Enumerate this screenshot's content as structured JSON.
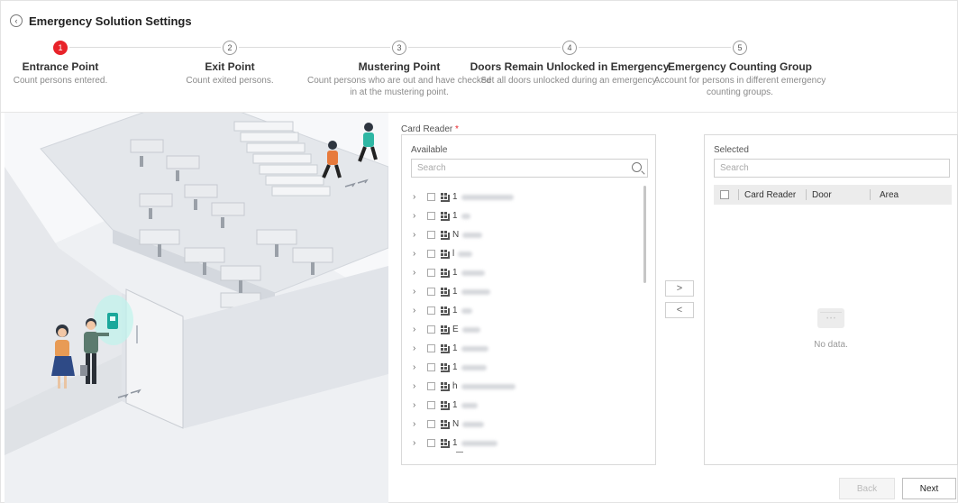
{
  "header": {
    "title": "Emergency Solution Settings",
    "back_icon": "back-circle-icon"
  },
  "stepper": {
    "active_step": 1,
    "accent_color": "#e8232a",
    "steps": [
      {
        "number": "1",
        "label": "Entrance Point",
        "desc": [
          "Count persons entered."
        ]
      },
      {
        "number": "2",
        "label": "Exit Point",
        "desc": [
          "Count exited persons."
        ]
      },
      {
        "number": "3",
        "label": "Mustering Point",
        "desc": [
          "Count persons who are out and have checked",
          "in at the mustering point."
        ]
      },
      {
        "number": "4",
        "label": "Doors Remain Unlocked in Emergency",
        "desc": [
          "Set all doors unlocked during an emergency."
        ]
      },
      {
        "number": "5",
        "label": "Emergency Counting Group",
        "desc": [
          "Account for persons in different emergency",
          "counting groups."
        ]
      }
    ]
  },
  "card_reader": {
    "label": "Card Reader",
    "required_mark": "*",
    "available": {
      "title": "Available",
      "search_placeholder": "Search",
      "items": [
        {
          "prefix": "1",
          "blur": 58
        },
        {
          "prefix": "1",
          "blur": 10
        },
        {
          "prefix": "N",
          "blur": 22
        },
        {
          "prefix": "l",
          "blur": 16
        },
        {
          "prefix": "1",
          "blur": 26
        },
        {
          "prefix": "1",
          "blur": 32
        },
        {
          "prefix": "1",
          "blur": 12
        },
        {
          "prefix": "E",
          "blur": 20
        },
        {
          "prefix": "1",
          "blur": 30
        },
        {
          "prefix": "1",
          "blur": 28
        },
        {
          "prefix": "h",
          "blur": 60
        },
        {
          "prefix": "1",
          "blur": 18
        },
        {
          "prefix": "N",
          "blur": 24
        },
        {
          "prefix": "1",
          "blur": 40
        }
      ]
    },
    "selected": {
      "title": "Selected",
      "search_placeholder": "Search",
      "columns": [
        "Card Reader",
        "Door",
        "Area"
      ],
      "empty_text": "No data."
    },
    "move_right_label": ">",
    "move_left_label": "<"
  },
  "footer": {
    "back_label": "Back",
    "next_label": "Next"
  }
}
